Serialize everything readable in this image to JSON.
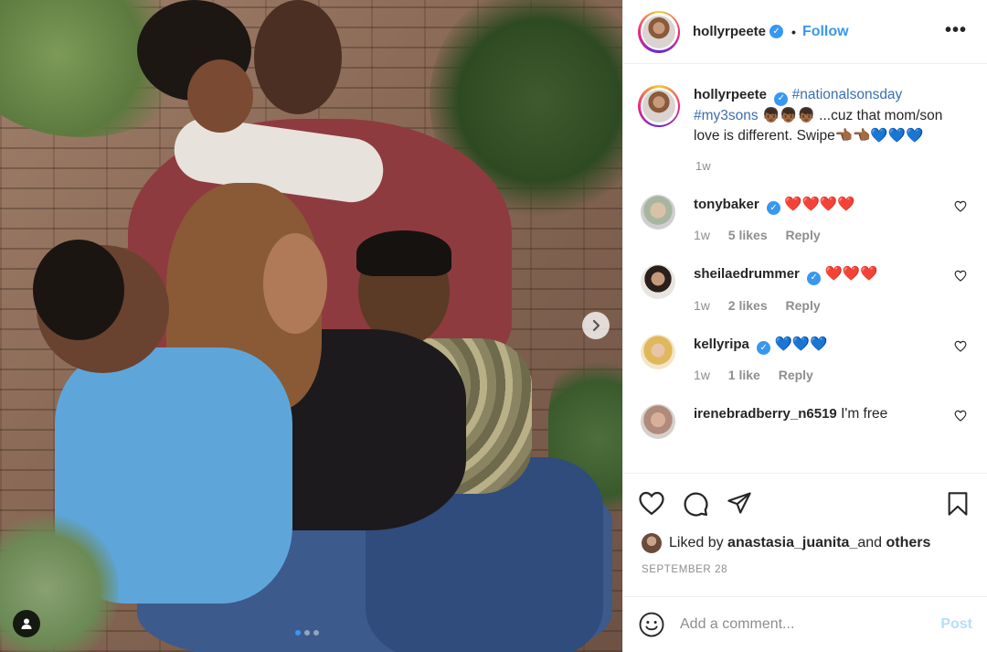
{
  "header": {
    "username": "hollyrpeete",
    "separator": "•",
    "follow_label": "Follow",
    "more_label": "•••"
  },
  "caption": {
    "username": "hollyrpeete",
    "hashtag1": "#nationalsonsday",
    "hashtag2": "#my3sons",
    "emoji_boys": "👦🏾👦🏾👦🏾",
    "text": " ...cuz that mom/son love is different. Swipe",
    "emoji_tail": "👈🏾👈🏾💙💙💙",
    "time": "1w"
  },
  "comments": [
    {
      "username": "tonybaker",
      "verified": true,
      "text": "❤️❤️❤️❤️",
      "time": "1w",
      "likes": "5 likes",
      "reply": "Reply"
    },
    {
      "username": "sheilaedrummer",
      "verified": true,
      "text": "❤️❤️❤️",
      "time": "1w",
      "likes": "2 likes",
      "reply": "Reply"
    },
    {
      "username": "kellyripa",
      "verified": true,
      "text": "💙💙💙",
      "time": "1w",
      "likes": "1 like",
      "reply": "Reply"
    },
    {
      "username": "irenebradberry_n6519",
      "verified": false,
      "text": "I'm free"
    }
  ],
  "liked_by": {
    "prefix": "Liked by ",
    "user": "anastasia_juanita_",
    "middle": " and ",
    "others": "others"
  },
  "date": "SEPTEMBER 28",
  "add_comment": {
    "placeholder": "Add a comment...",
    "post_label": "Post"
  },
  "colors": {
    "accent": "#3897f0",
    "heart": "#e0245e",
    "post_disabled": "#b2dffc",
    "muted": "#8e8e8e"
  }
}
